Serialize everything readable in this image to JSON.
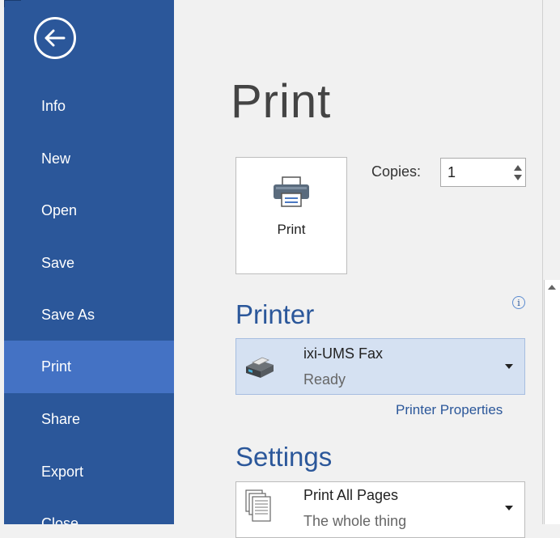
{
  "nav": {
    "items": [
      {
        "label": "Info"
      },
      {
        "label": "New"
      },
      {
        "label": "Open"
      },
      {
        "label": "Save"
      },
      {
        "label": "Save As"
      },
      {
        "label": "Print",
        "active": true
      },
      {
        "label": "Share"
      },
      {
        "label": "Export"
      },
      {
        "label": "Close"
      }
    ],
    "back_icon": "back-arrow-icon"
  },
  "page": {
    "title": "Print"
  },
  "print_button": {
    "label": "Print",
    "icon": "printer-icon"
  },
  "copies": {
    "label": "Copies:",
    "value": "1"
  },
  "printer": {
    "heading": "Printer",
    "info_icon": "info-icon",
    "selected_name": "ixi-UMS Fax",
    "selected_status": "Ready",
    "properties_link": "Printer Properties"
  },
  "settings": {
    "heading": "Settings",
    "pages_option": "Print All Pages",
    "pages_option_sub": "The whole thing"
  },
  "colors": {
    "sidebar": "#2b579a",
    "sidebar_active": "#4472c4",
    "accent": "#2b579a",
    "selected_printer_bg": "#d5e1f2"
  }
}
